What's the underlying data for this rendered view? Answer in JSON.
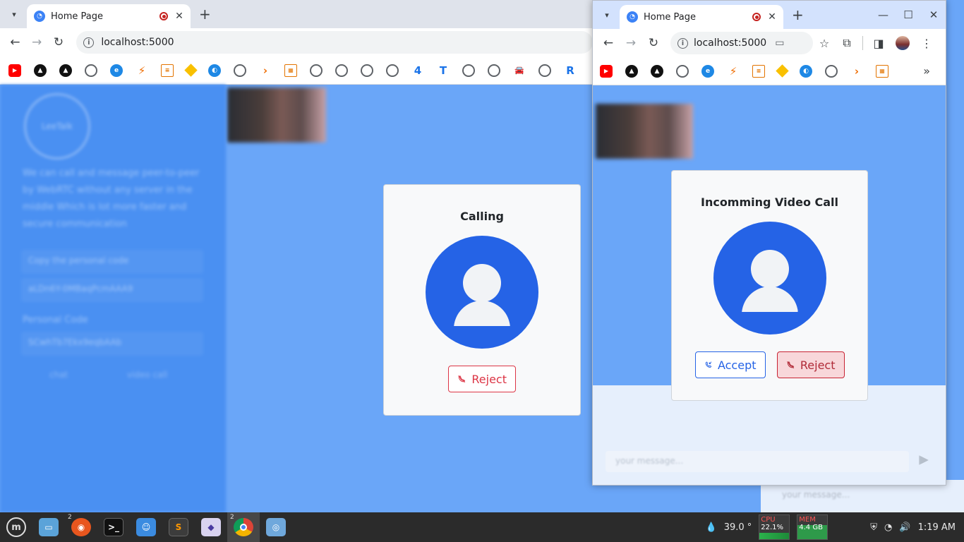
{
  "left_browser": {
    "tab": {
      "title": "Home Page"
    },
    "url": "localhost:5000",
    "bookmarks": [
      "youtube",
      "triangle",
      "triangle",
      "globe",
      "edge",
      "lightning",
      "doc",
      "diamond",
      "shield",
      "peak",
      "arrows",
      "fff",
      "globe",
      "globe",
      "globe",
      "globe",
      "4",
      "T2",
      "globe",
      "globe",
      "car",
      "globe",
      "R"
    ],
    "bookmark_labels": {
      "four": "4",
      "t2": "T",
      "r": "R"
    }
  },
  "left_page": {
    "sidebar": {
      "logo_text": "LeeTalk",
      "description": "We can call and message peer-to-peer by WebRTC without any server in the middle Which is lot more faster and secure communication",
      "copy_label": "Copy the personal code",
      "copy_value": "aLDn6Y-0MBaqPcmAAA9",
      "personal_code_label": "Personal Code",
      "personal_code_value": "SCwhTb7Ekx9eqbAAb",
      "chat_label": "chat",
      "video_call_label": "video call"
    },
    "chat_placeholder": "your message...",
    "calling_dialog": {
      "title": "Calling",
      "reject_label": "Reject"
    }
  },
  "right_browser": {
    "tab": {
      "title": "Home Page"
    },
    "url": "localhost:5000",
    "window_controls": [
      "minimize",
      "maximize",
      "close"
    ]
  },
  "right_page": {
    "incoming_dialog": {
      "title": "Incomming Video Call",
      "accept_label": "Accept",
      "reject_label": "Reject"
    },
    "message_placeholder": "your message..."
  },
  "taskbar": {
    "firefox_badge": "2",
    "chrome_badge": "2",
    "temperature": "39.0 °",
    "cpu_label": "CPU",
    "cpu_value": "22.1%",
    "mem_label": "MEM",
    "mem_value": "4.4 GB",
    "clock": "1:19 AM"
  },
  "colors": {
    "page_blue": "#6aa6f8",
    "avatar_blue": "#2563e6",
    "reject_red": "#dc3545"
  }
}
